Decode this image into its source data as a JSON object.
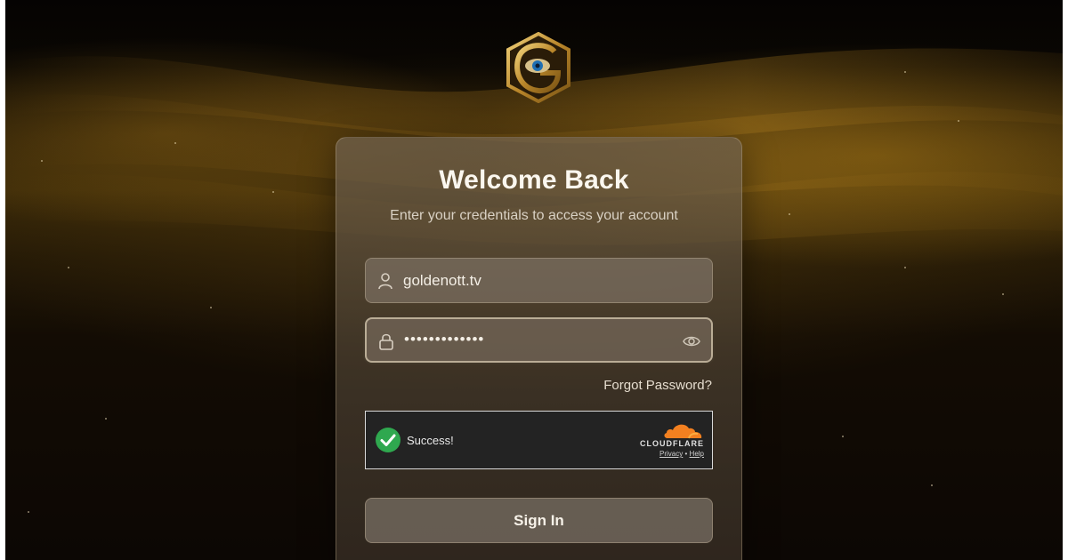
{
  "login": {
    "title": "Welcome Back",
    "subtitle": "Enter your credentials to access your account",
    "username": {
      "value": "goldenott.tv",
      "icon": "user-icon"
    },
    "password": {
      "masked_value": "•••••••••••••",
      "icon": "lock-icon",
      "toggle_icon": "eye-icon"
    },
    "forgot_password_label": "Forgot Password?",
    "sign_in_label": "Sign In"
  },
  "captcha": {
    "status": "Success!",
    "brand": "CLOUDFLARE",
    "privacy_label": "Privacy",
    "separator": "•",
    "help_label": "Help"
  },
  "colors": {
    "accent_gold": "#c8962a",
    "success_green": "#2fa84f",
    "cloudflare_orange": "#f38020"
  }
}
